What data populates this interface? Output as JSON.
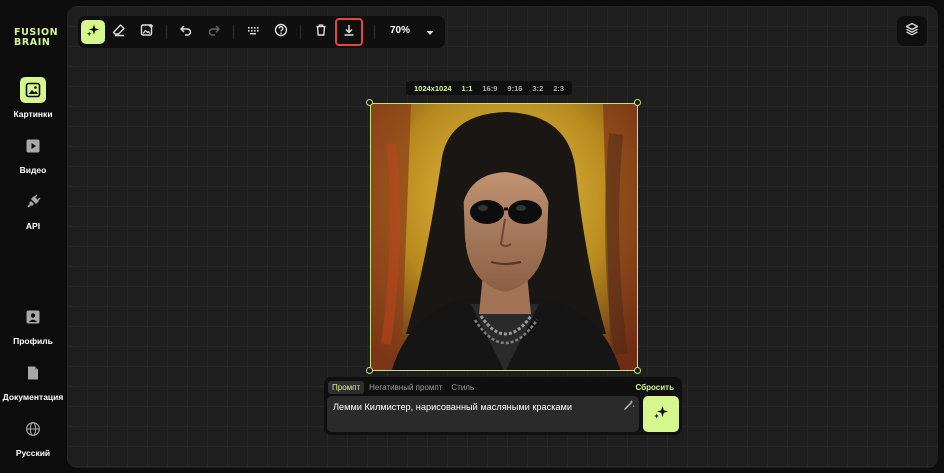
{
  "brand": {
    "line1": "FUSION",
    "line2": "BRAIN",
    "color": "#d5f78d"
  },
  "sidebar": {
    "items": [
      {
        "label": "Картинки",
        "icon": "image-icon",
        "active": true
      },
      {
        "label": "Видео",
        "icon": "video-play-icon",
        "active": false
      },
      {
        "label": "API",
        "icon": "plug-icon",
        "active": false
      },
      {
        "label": "Профиль",
        "icon": "profile-icon",
        "active": false
      },
      {
        "label": "Документация",
        "icon": "document-icon",
        "active": false
      },
      {
        "label": "Русский",
        "icon": "globe-icon",
        "active": false
      }
    ]
  },
  "toolbar": {
    "tools": [
      "sparkle-generate-icon",
      "eraser-icon",
      "image-upload-icon",
      "undo-icon",
      "redo-icon",
      "keyboard-shortcuts-icon",
      "help-icon",
      "trash-icon",
      "download-icon"
    ],
    "zoom": "70%"
  },
  "ratio": {
    "size": "1024x1024",
    "options": [
      "1:1",
      "16:9",
      "9:16",
      "3:2",
      "2:3"
    ],
    "selected": "1:1"
  },
  "prompt": {
    "tabs": [
      "Промпт",
      "Негативный промпт",
      "Стиль"
    ],
    "active_tab": "Промпт",
    "reset_label": "Сбросить",
    "value": "Лемми Килмистер, нарисованный масляными красками"
  },
  "colors": {
    "accent": "#d5f78d",
    "highlight": "#e5463d",
    "canvas": "#1e1e1e"
  }
}
